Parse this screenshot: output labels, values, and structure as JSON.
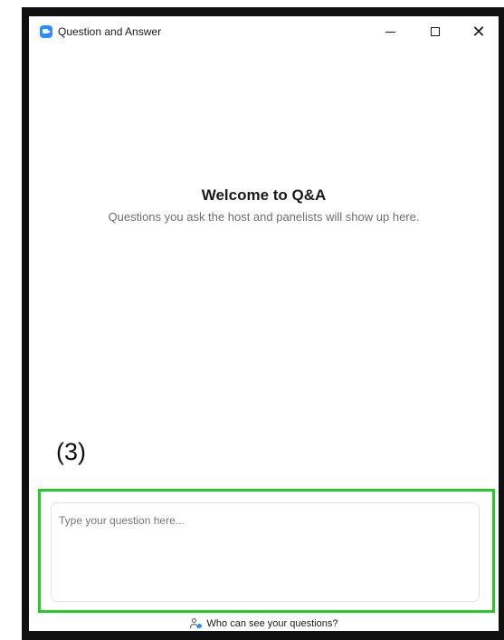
{
  "window": {
    "title": "Question and Answer",
    "controls": {
      "minimize_icon": "minimize-icon",
      "maximize_icon": "maximize-icon",
      "close_glyph": "✕"
    }
  },
  "welcome": {
    "heading": "Welcome to Q&A",
    "message": "Questions you ask the host and panelists will show up here."
  },
  "annotation": {
    "label": "(3)",
    "highlight_color": "#22cc22"
  },
  "question_input": {
    "placeholder": "Type your question here...",
    "value": ""
  },
  "footer": {
    "link_label": "Who can see your questions?",
    "icon": "people-icon"
  },
  "colors": {
    "accent": "#2d8cff",
    "frame": "#101010"
  }
}
